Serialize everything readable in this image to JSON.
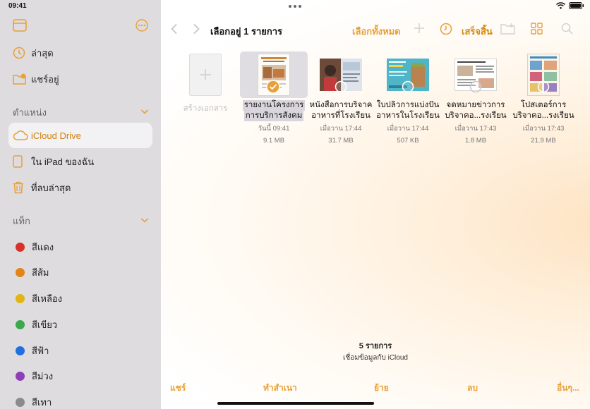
{
  "status": {
    "time": "09:41"
  },
  "sidebar": {
    "primary": [
      {
        "label": "ล่าสุด"
      },
      {
        "label": "แชร์อยู่"
      }
    ],
    "locations": {
      "heading": "ตำแหน่ง",
      "items": [
        {
          "label": "iCloud Drive",
          "selected": true
        },
        {
          "label": "ใน iPad ของฉัน"
        },
        {
          "label": "ที่ลบล่าสุด"
        }
      ]
    },
    "tags": {
      "heading": "แท็ก",
      "items": [
        {
          "label": "สีแดง",
          "color": "#d9302b"
        },
        {
          "label": "สีส้ม",
          "color": "#e18516"
        },
        {
          "label": "สีเหลือง",
          "color": "#e1b513"
        },
        {
          "label": "สีเขียว",
          "color": "#3aa94b"
        },
        {
          "label": "สีฟ้า",
          "color": "#1f6fe0"
        },
        {
          "label": "สีม่วง",
          "color": "#8e3fb7"
        },
        {
          "label": "สีเทา",
          "color": "#8b8b8e"
        }
      ]
    }
  },
  "toolbar": {
    "title": "เลือกอยู่ 1 รายการ",
    "select_all": "เลือกทั้งหมด",
    "done": "เสร็จสิ้น"
  },
  "create": {
    "label": "สร้างเอกสาร"
  },
  "files": [
    {
      "name_line1": "รายงานโครงการ",
      "name_line2": "การบริการสังคม",
      "date": "วันนี้ 09:41",
      "size": "9.1 MB",
      "selected": true
    },
    {
      "name_line1": "หนังสือการบริจาค",
      "name_line2": "อาหารที่โรงเรียน",
      "date": "เมื่อวาน 17:44",
      "size": "31.7 MB",
      "selected": false
    },
    {
      "name_line1": "ใบปลิวการแบ่งปัน",
      "name_line2": "อาหารในโรงเรียน",
      "date": "เมื่อวาน 17:44",
      "size": "507 KB",
      "selected": false
    },
    {
      "name_line1": "จดหมายข่าวการ",
      "name_line2": "บริจาคอ...รงเรียน",
      "date": "เมื่อวาน 17:43",
      "size": "1.8 MB",
      "selected": false
    },
    {
      "name_line1": "โปสเตอร์การ",
      "name_line2": "บริจาคอ...รงเรียน",
      "date": "เมื่อวาน 17:43",
      "size": "21.9 MB",
      "selected": false
    }
  ],
  "footer": {
    "count": "5 รายการ",
    "sync": "เชื่อมข้อมูลกับ iCloud"
  },
  "actions": {
    "share": "แชร์",
    "duplicate": "ทำสำเนา",
    "move": "ย้าย",
    "delete": "ลบ",
    "more": "อื่นๆ..."
  },
  "colors": {
    "accent": "#e8a039",
    "sidebar_bg": "#dedcdf",
    "selected_row": "#f2f1f3"
  }
}
